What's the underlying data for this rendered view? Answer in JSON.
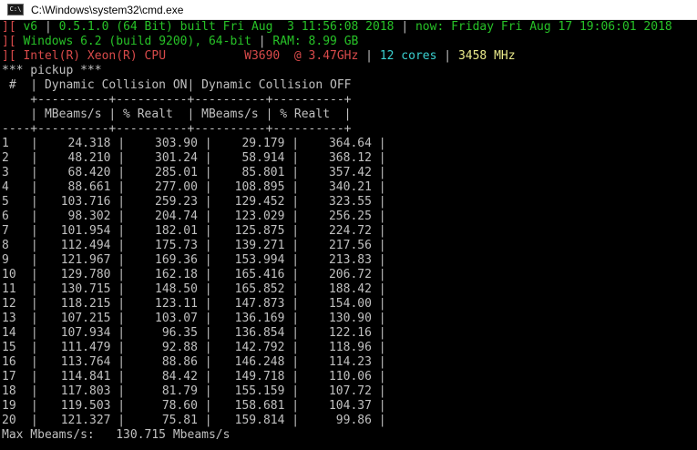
{
  "window": {
    "title": "C:\\Windows\\system32\\cmd.exe",
    "icon_text": "C:\\"
  },
  "header": {
    "l1_version": "v6",
    "l1_build": "0.5.1.0 (64 Bit) built Fri Aug  3 11:56:08 2018",
    "l1_now": "now: Friday Fri Aug 17 19:06:01 2018",
    "l2_os": "Windows 6.2 (build 9200), 64-bit",
    "l2_ram": "RAM: 8.99 GB",
    "l3_cpu": "Intel(R) Xeon(R) CPU           W3690  @ 3.47GHz",
    "l3_cores": "12 cores",
    "l3_mhz": "3458 MHz"
  },
  "bench": {
    "scene": "*** pickup ***",
    "header_line": " #  | Dynamic Collision ON| Dynamic Collision OFF",
    "sep1": "    +----------+----------+----------+----------+",
    "subheader_line": "    | MBeams/s | % Realt  | MBeams/s | % Realt  |",
    "sep2": "----+----------+----------+----------+----------+",
    "rows": [
      {
        "n": "1",
        "on_mb": "24.318",
        "on_rt": "303.90",
        "off_mb": "29.179",
        "off_rt": "364.64"
      },
      {
        "n": "2",
        "on_mb": "48.210",
        "on_rt": "301.24",
        "off_mb": "58.914",
        "off_rt": "368.12"
      },
      {
        "n": "3",
        "on_mb": "68.420",
        "on_rt": "285.01",
        "off_mb": "85.801",
        "off_rt": "357.42"
      },
      {
        "n": "4",
        "on_mb": "88.661",
        "on_rt": "277.00",
        "off_mb": "108.895",
        "off_rt": "340.21"
      },
      {
        "n": "5",
        "on_mb": "103.716",
        "on_rt": "259.23",
        "off_mb": "129.452",
        "off_rt": "323.55"
      },
      {
        "n": "6",
        "on_mb": "98.302",
        "on_rt": "204.74",
        "off_mb": "123.029",
        "off_rt": "256.25"
      },
      {
        "n": "7",
        "on_mb": "101.954",
        "on_rt": "182.01",
        "off_mb": "125.875",
        "off_rt": "224.72"
      },
      {
        "n": "8",
        "on_mb": "112.494",
        "on_rt": "175.73",
        "off_mb": "139.271",
        "off_rt": "217.56"
      },
      {
        "n": "9",
        "on_mb": "121.967",
        "on_rt": "169.36",
        "off_mb": "153.994",
        "off_rt": "213.83"
      },
      {
        "n": "10",
        "on_mb": "129.780",
        "on_rt": "162.18",
        "off_mb": "165.416",
        "off_rt": "206.72"
      },
      {
        "n": "11",
        "on_mb": "130.715",
        "on_rt": "148.50",
        "off_mb": "165.852",
        "off_rt": "188.42"
      },
      {
        "n": "12",
        "on_mb": "118.215",
        "on_rt": "123.11",
        "off_mb": "147.873",
        "off_rt": "154.00"
      },
      {
        "n": "13",
        "on_mb": "107.215",
        "on_rt": "103.07",
        "off_mb": "136.169",
        "off_rt": "130.90"
      },
      {
        "n": "14",
        "on_mb": "107.934",
        "on_rt": "96.35",
        "off_mb": "136.854",
        "off_rt": "122.16"
      },
      {
        "n": "15",
        "on_mb": "111.479",
        "on_rt": "92.88",
        "off_mb": "142.792",
        "off_rt": "118.96"
      },
      {
        "n": "16",
        "on_mb": "113.764",
        "on_rt": "88.86",
        "off_mb": "146.248",
        "off_rt": "114.23"
      },
      {
        "n": "17",
        "on_mb": "114.841",
        "on_rt": "84.42",
        "off_mb": "149.718",
        "off_rt": "110.06"
      },
      {
        "n": "18",
        "on_mb": "117.803",
        "on_rt": "81.79",
        "off_mb": "155.159",
        "off_rt": "107.72"
      },
      {
        "n": "19",
        "on_mb": "119.503",
        "on_rt": "78.60",
        "off_mb": "158.681",
        "off_rt": "104.37"
      },
      {
        "n": "20",
        "on_mb": "121.327",
        "on_rt": "75.81",
        "off_mb": "159.814",
        "off_rt": "99.86"
      }
    ],
    "max_line": "Max Mbeams/s:   130.715 Mbeams/s"
  }
}
